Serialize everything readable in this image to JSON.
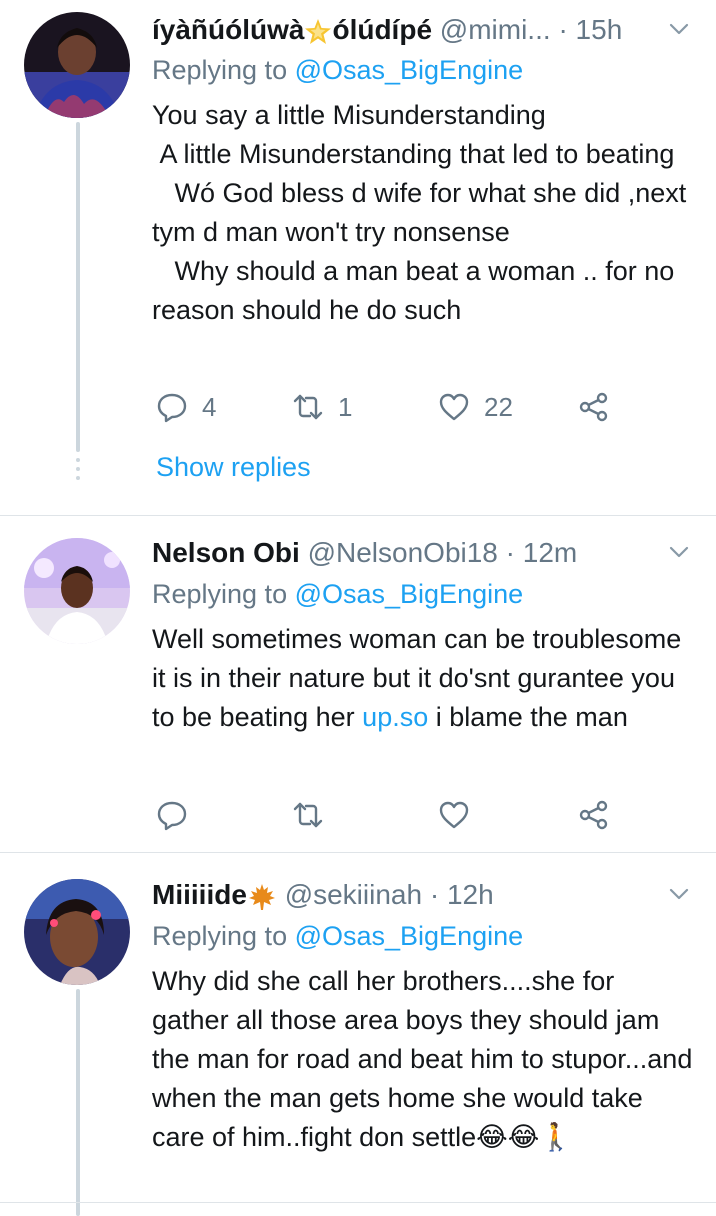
{
  "tweets": [
    {
      "name": "íyàñúólúwà",
      "name2": "ólúdípé",
      "handle": "@mimi...",
      "sep": "·",
      "time": "15h",
      "reply_prefix": "Replying to ",
      "reply_to": "@Osas_BigEngine",
      "text": "You say a little Misunderstanding\n A little Misunderstanding that led to beating\n   Wó God bless d wife for what she did ,next tym d man won't try nonsense\n   Why should a man beat a woman .. for no reason should he do such",
      "replies": "4",
      "retweets": "1",
      "likes": "22",
      "show_replies": "Show replies"
    },
    {
      "name": "Nelson Obi",
      "handle": "@NelsonObi18",
      "sep": "·",
      "time": "12m",
      "reply_prefix": "Replying to ",
      "reply_to": "@Osas_BigEngine",
      "text_before_link": "Well sometimes woman can be troublesome it is in their nature but it do'snt gurantee you to be beating her ",
      "link_text": "up.so",
      "text_after_link": " i blame the man"
    },
    {
      "name": "Miiiiide",
      "handle": "@sekiiinah",
      "sep": "·",
      "time": "12h",
      "reply_prefix": "Replying to ",
      "reply_to": "@Osas_BigEngine",
      "text": "Why did she call her brothers....she for gather all those area boys they should jam the man for road and beat him to stupor...and when the man gets home she would take care of him..fight don settle😂😂🚶"
    }
  ],
  "colors": {
    "link": "#1da1f2",
    "secondary": "#657786",
    "divider": "#dfe4e8",
    "thread": "#ccd6dd"
  },
  "icons": [
    "reply-icon",
    "retweet-icon",
    "like-icon",
    "share-icon",
    "chevron-down-icon",
    "star-emoji",
    "maple-leaf-emoji"
  ]
}
